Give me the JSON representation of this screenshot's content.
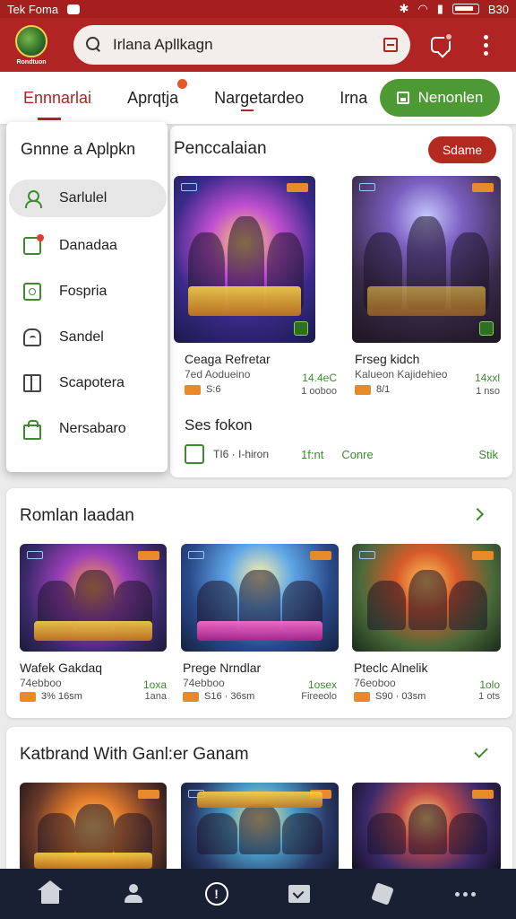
{
  "status_bar": {
    "left_text": "Tek Foma",
    "right_text": "B30"
  },
  "header": {
    "logo_text": "Rondtuon",
    "search": {
      "value": "Irlana Apllkagn",
      "placeholder": ""
    }
  },
  "tabs": [
    {
      "label": "Ennnarlai",
      "active": true
    },
    {
      "label": "Aprqtja",
      "badge": true
    },
    {
      "label": "Nargetardeo"
    },
    {
      "label": "Irna"
    }
  ],
  "tabs_action": {
    "label": "Nenonlen"
  },
  "drawer": {
    "title": "Gnnne a Aplpkn",
    "items": [
      {
        "label": "Sarlulel",
        "icon": "person-icon",
        "active": true
      },
      {
        "label": "Danadaa",
        "icon": "inbox-icon"
      },
      {
        "label": "Fospria",
        "icon": "settings-box-icon"
      },
      {
        "label": "Sandel",
        "icon": "cloud-icon"
      },
      {
        "label": "Scapotera",
        "icon": "book-icon"
      },
      {
        "label": "Nersabaro",
        "icon": "bag-icon"
      }
    ]
  },
  "section1": {
    "title": "Penccalaian",
    "button": "Sdame",
    "games": [
      {
        "title": "Ceaga Refretar",
        "sub": "7ed Aodueino",
        "tag": "S:6",
        "right1": "14.4eC",
        "right2": "1 ooboo"
      },
      {
        "title": "Frseg kidch",
        "sub": "Kalueon Kajidehieo",
        "tag": "8/1",
        "right1": "14xxl",
        "right2": "1 nso"
      }
    ],
    "row": {
      "title": "Ses fokon",
      "meta": "TI6 · I-hiron",
      "value1": "1f:nt",
      "value2": "Conre",
      "value3": "Stik"
    }
  },
  "section2": {
    "title": "Romlan laadan",
    "games": [
      {
        "title": "Wafek Gakdaq",
        "sub": "74ebboo",
        "tag": "3% 16sm",
        "right1": "1oxa",
        "right2": "1ana"
      },
      {
        "title": "Prege Nrndlar",
        "sub": "74ebboo",
        "tag": "S16 · 36sm",
        "right1": "1osex",
        "right2": "Fireeolo"
      },
      {
        "title": "Pteclc Alnelik",
        "sub": "76eoboo",
        "tag": "S90 · 03sm",
        "right1": "1olo",
        "right2": "1 ots"
      }
    ]
  },
  "section3": {
    "title": "Katbrand With Ganl:er Ganam"
  },
  "colors": {
    "brand_red": "#b02424",
    "accent_green": "#4d9a34",
    "nav_dark": "#1a2033"
  }
}
